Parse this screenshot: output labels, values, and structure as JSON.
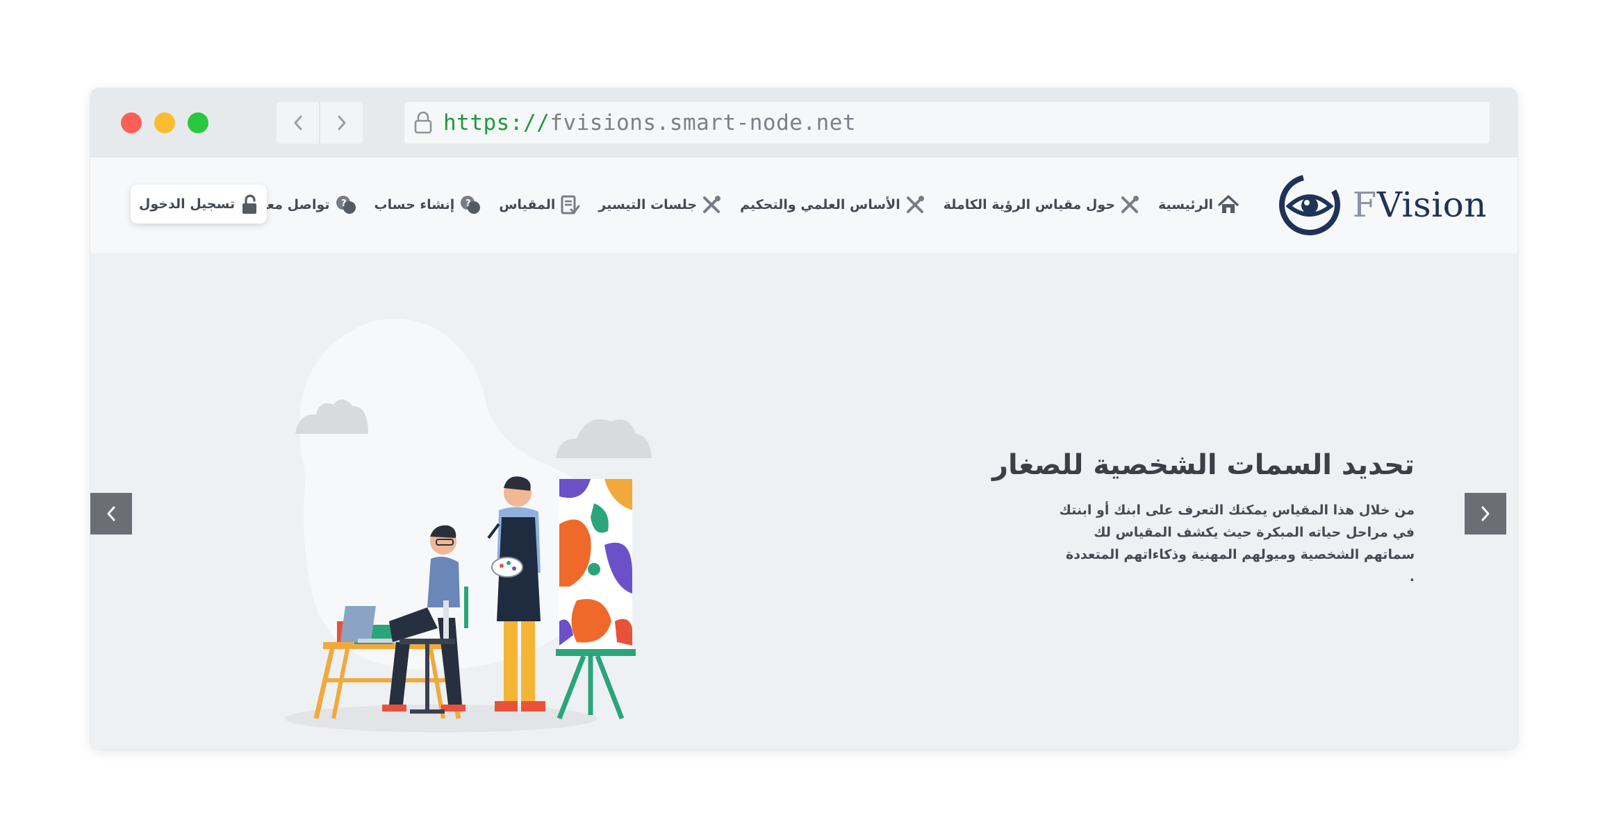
{
  "browser": {
    "url_scheme": "https://",
    "url_rest": "fvisions.smart-node.net",
    "traffic_lights": {
      "close": "#fe5f57",
      "minimize": "#fdbc2e",
      "maximize": "#28c840"
    }
  },
  "site": {
    "logo_text_initial": "F",
    "logo_text_rest": "Vision",
    "nav": [
      {
        "label": "الرئيسية",
        "icon": "home-icon"
      },
      {
        "label": "حول مقياس الرؤية الكاملة",
        "icon": "tools-icon"
      },
      {
        "label": "الأساس العلمي والتحكيم",
        "icon": "tools-icon"
      },
      {
        "label": "جلسات التيسير",
        "icon": "tools-icon"
      },
      {
        "label": "المقياس",
        "icon": "checklist-icon"
      },
      {
        "label": "إنشاء حساب",
        "icon": "chat-icon"
      },
      {
        "label": "تواصل معنا",
        "icon": "chat-icon"
      }
    ],
    "login_label": "تسجيل الدخول",
    "login_icon": "unlock-icon"
  },
  "hero": {
    "title": "تحديد السمات الشخصية للصغار",
    "body_line1": "من خلال هذا المقياس يمكنك التعرف على ابنك أو ابنتك",
    "body_line2": "في مراحل حياته المبكرة حيث يكشف المقياس لك",
    "body_line3": "سماتهم الشخصية وميولهم المهنية وذكاءاتهم المتعددة",
    "body_line4": "."
  },
  "colors": {
    "brand_dark": "#1e3355",
    "text": "#444a52",
    "arrow_bg": "#6b6f75",
    "hero_bg": "#eef1f4"
  }
}
